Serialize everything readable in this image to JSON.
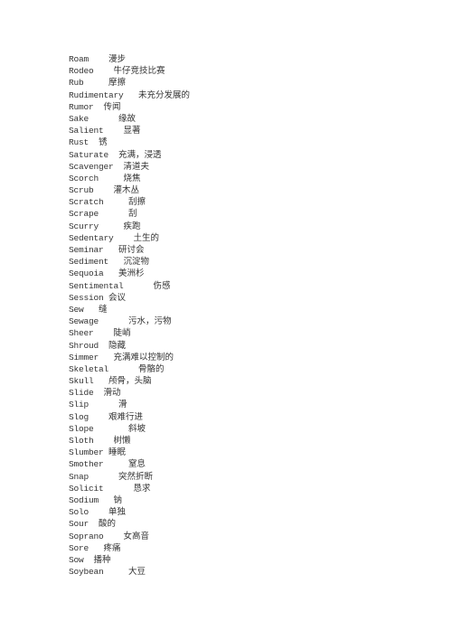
{
  "vocabulary": [
    {
      "en": "Roam",
      "gap": "    ",
      "zh": "漫步"
    },
    {
      "en": "Rodeo",
      "gap": "    ",
      "zh": "牛仔竞技比赛"
    },
    {
      "en": "Rub",
      "gap": "     ",
      "zh": "摩擦"
    },
    {
      "en": "Rudimentary",
      "gap": "   ",
      "zh": "未充分发展的"
    },
    {
      "en": "Rumor",
      "gap": "  ",
      "zh": "传闻"
    },
    {
      "en": "Sake",
      "gap": "      ",
      "zh": "缘故"
    },
    {
      "en": "Salient",
      "gap": "    ",
      "zh": "显著"
    },
    {
      "en": "Rust",
      "gap": "  ",
      "zh": "锈"
    },
    {
      "en": "Saturate",
      "gap": "  ",
      "zh": "充满，浸透"
    },
    {
      "en": "Scavenger",
      "gap": "  ",
      "zh": "清道夫"
    },
    {
      "en": "Scorch",
      "gap": "     ",
      "zh": "烧焦"
    },
    {
      "en": "Scrub",
      "gap": "    ",
      "zh": "灌木丛"
    },
    {
      "en": "Scratch",
      "gap": "     ",
      "zh": "刮擦"
    },
    {
      "en": "Scrape",
      "gap": "      ",
      "zh": "刮"
    },
    {
      "en": "Scurry",
      "gap": "     ",
      "zh": "疾跑"
    },
    {
      "en": "Sedentary",
      "gap": "    ",
      "zh": "土生的"
    },
    {
      "en": "Seminar",
      "gap": "   ",
      "zh": "研讨会"
    },
    {
      "en": "Sediment",
      "gap": "   ",
      "zh": "沉淀物"
    },
    {
      "en": "Sequoia",
      "gap": "   ",
      "zh": "美洲杉"
    },
    {
      "en": "Sentimental",
      "gap": "      ",
      "zh": "伤感"
    },
    {
      "en": "Session",
      "gap": " ",
      "zh": "会议"
    },
    {
      "en": "Sew",
      "gap": "   ",
      "zh": "缝"
    },
    {
      "en": "Sewage",
      "gap": "      ",
      "zh": "污水，污物"
    },
    {
      "en": "Sheer",
      "gap": "    ",
      "zh": "陡峭"
    },
    {
      "en": "Shroud",
      "gap": "  ",
      "zh": "隐藏"
    },
    {
      "en": "Simmer",
      "gap": "   ",
      "zh": "充满难以控制的"
    },
    {
      "en": "Skeletal",
      "gap": "      ",
      "zh": "骨骼的"
    },
    {
      "en": "Skull",
      "gap": "   ",
      "zh": "颅骨，头脑"
    },
    {
      "en": "Slide",
      "gap": "  ",
      "zh": "滑动"
    },
    {
      "en": "Slip",
      "gap": "      ",
      "zh": "滑"
    },
    {
      "en": "Slog",
      "gap": "    ",
      "zh": "艰难行进"
    },
    {
      "en": "Slope",
      "gap": "       ",
      "zh": "斜坡"
    },
    {
      "en": "Sloth",
      "gap": "    ",
      "zh": "树懒"
    },
    {
      "en": "Slumber",
      "gap": " ",
      "zh": "睡眠"
    },
    {
      "en": "Smother",
      "gap": "     ",
      "zh": "窒息"
    },
    {
      "en": "Snap",
      "gap": "      ",
      "zh": "突然折断"
    },
    {
      "en": "Solicit",
      "gap": "      ",
      "zh": "恳求"
    },
    {
      "en": "Sodium",
      "gap": "   ",
      "zh": "钠"
    },
    {
      "en": "Solo",
      "gap": "    ",
      "zh": "单独"
    },
    {
      "en": "Sour",
      "gap": "  ",
      "zh": "酸的"
    },
    {
      "en": "Soprano",
      "gap": "    ",
      "zh": "女高音"
    },
    {
      "en": "Sore",
      "gap": "   ",
      "zh": "疼痛"
    },
    {
      "en": "Sow",
      "gap": "  ",
      "zh": "播种"
    },
    {
      "en": "Soybean",
      "gap": "     ",
      "zh": "大豆"
    }
  ]
}
